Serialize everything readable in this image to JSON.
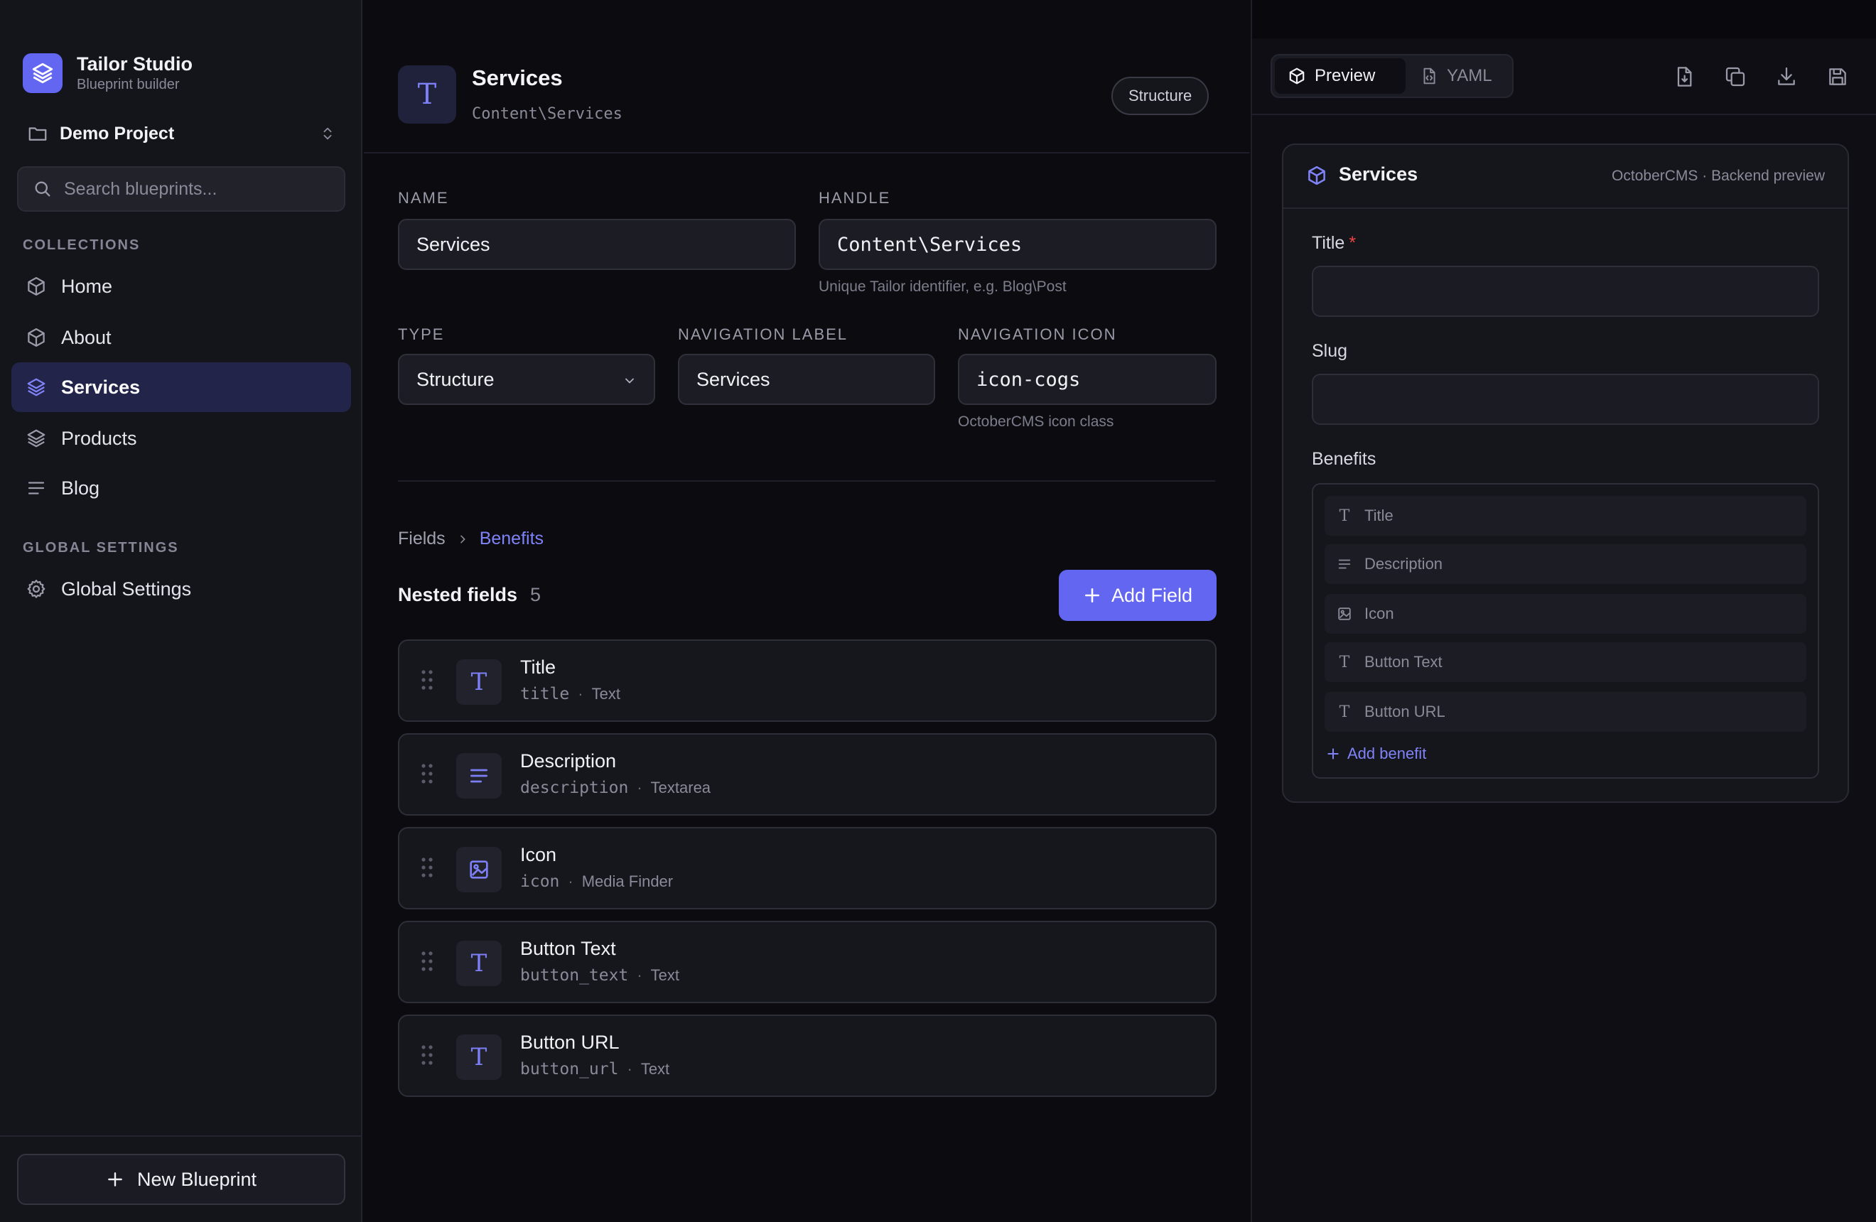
{
  "brand": {
    "name": "Tailor Studio",
    "subtitle": "Blueprint builder",
    "icon": "layers-icon",
    "accent": "#6366f1"
  },
  "project": {
    "name": "Demo Project",
    "icon": "folder-icon"
  },
  "search": {
    "placeholder": "Search blueprints..."
  },
  "sidebar": {
    "collections_label": "COLLECTIONS",
    "items": [
      {
        "label": "Home",
        "icon": "cube-icon",
        "active": false
      },
      {
        "label": "About",
        "icon": "cube-icon",
        "active": false
      },
      {
        "label": "Services",
        "icon": "layers-icon",
        "active": true
      },
      {
        "label": "Products",
        "icon": "layers-icon",
        "active": false
      },
      {
        "label": "Blog",
        "icon": "list-icon",
        "active": false
      }
    ],
    "global_label": "GLOBAL SETTINGS",
    "global_items": [
      {
        "label": "Global Settings",
        "icon": "gear-icon"
      }
    ],
    "new_blueprint": "New Blueprint"
  },
  "main": {
    "title": "Services",
    "handle": "Content\\Services",
    "type_badge": "Structure",
    "icon_glyph": "T",
    "form": {
      "name_label": "NAME",
      "name_value": "Services",
      "handle_label": "HANDLE",
      "handle_value": "Content\\Services",
      "handle_help": "Unique Tailor identifier, e.g. Blog\\Post",
      "type_label": "TYPE",
      "type_value": "Structure",
      "nav_label_label": "NAVIGATION LABEL",
      "nav_label_value": "Services",
      "nav_icon_label": "NAVIGATION ICON",
      "nav_icon_value": "icon-cogs",
      "nav_icon_help": "OctoberCMS icon class"
    },
    "breadcrumb": {
      "root": "Fields",
      "current": "Benefits"
    },
    "nested": {
      "title": "Nested fields",
      "count": "5"
    },
    "add_field": "Add Field",
    "fields": [
      {
        "name": "Title",
        "key": "title",
        "type": "Text",
        "icon": "text-icon"
      },
      {
        "name": "Description",
        "key": "description",
        "type": "Textarea",
        "icon": "textarea-icon"
      },
      {
        "name": "Icon",
        "key": "icon",
        "type": "Media Finder",
        "icon": "image-icon"
      },
      {
        "name": "Button Text",
        "key": "button_text",
        "type": "Text",
        "icon": "text-icon"
      },
      {
        "name": "Button URL",
        "key": "button_url",
        "type": "Text",
        "icon": "text-icon"
      }
    ]
  },
  "preview": {
    "tabs": [
      {
        "label": "Preview",
        "icon": "cube-icon",
        "active": true
      },
      {
        "label": "YAML",
        "icon": "code-file-icon",
        "active": false
      }
    ],
    "toolbar_icons": [
      "export-file-icon",
      "copy-icon",
      "download-icon",
      "save-icon"
    ],
    "card_title": "Services",
    "card_subtitle": "OctoberCMS · Backend preview",
    "title_label": "Title",
    "required_mark": "*",
    "slug_label": "Slug",
    "benefits_label": "Benefits",
    "benefit_items": [
      {
        "label": "Title",
        "icon": "text-icon"
      },
      {
        "label": "Description",
        "icon": "textarea-icon"
      },
      {
        "label": "Icon",
        "icon": "image-icon"
      },
      {
        "label": "Button Text",
        "icon": "text-icon"
      },
      {
        "label": "Button URL",
        "icon": "text-icon"
      }
    ],
    "add_benefit": "Add benefit"
  }
}
